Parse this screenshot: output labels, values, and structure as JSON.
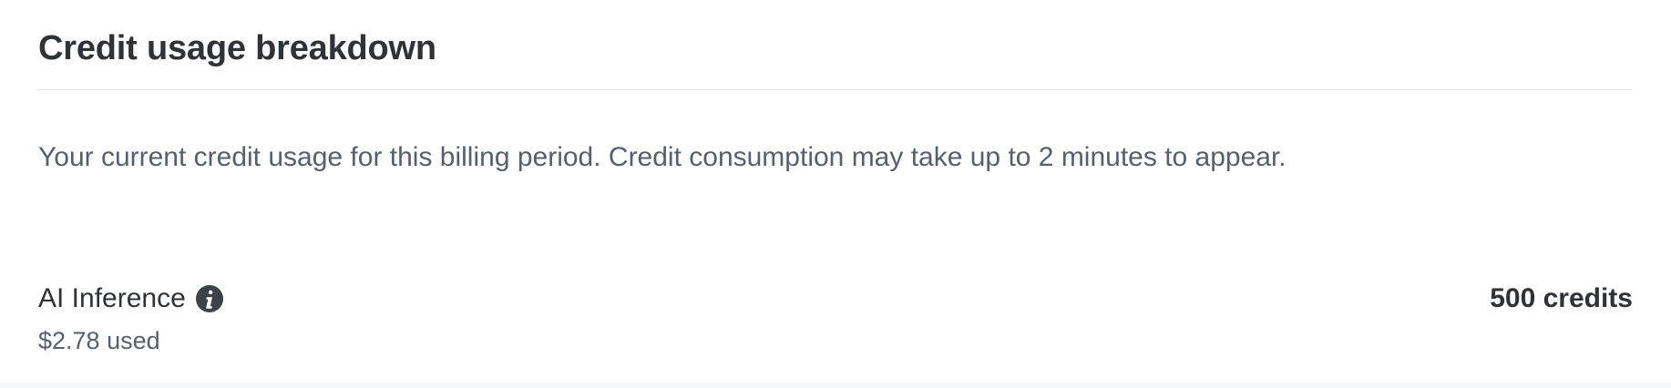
{
  "section": {
    "title": "Credit usage breakdown",
    "description": "Your current credit usage for this billing period. Credit consumption may take up to 2 minutes to appear."
  },
  "usage": [
    {
      "name": "AI Inference",
      "info_icon": "info-icon",
      "used": "$2.78 used",
      "credits": "500 credits"
    }
  ]
}
